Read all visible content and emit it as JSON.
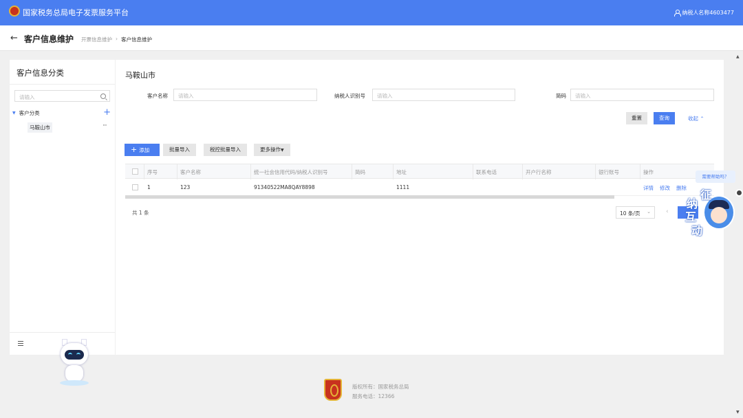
{
  "header": {
    "app_title": "国家税务总局电子发票服务平台",
    "user_name": "纳税人名称4603477"
  },
  "subheader": {
    "page_title": "客户信息维护",
    "breadcrumb": [
      "开票信息维护",
      "客户信息维护"
    ]
  },
  "sidebar": {
    "title": "客户信息分类",
    "search_placeholder": "请输入",
    "tree_root": "客户分类",
    "tree_child": "马鞍山市"
  },
  "main": {
    "region_title": "马鞍山市",
    "form": {
      "customer_name_label": "客户名称",
      "customer_name_placeholder": "请输入",
      "taxpayer_id_label": "纳税人识别号",
      "taxpayer_id_placeholder": "请输入",
      "abbr_label": "简码",
      "abbr_placeholder": "请输入",
      "reset": "重置",
      "query": "查询",
      "collapse": "收起"
    },
    "toolbar": {
      "add": "添加",
      "batch_import": "批量导入",
      "taxctrl_import": "税控批量导入",
      "more": "更多操作"
    },
    "table": {
      "headers": [
        "序号",
        "客户名称",
        "统一社会信用代码/纳税人识别号",
        "简码",
        "地址",
        "联系电话",
        "开户行名称",
        "银行账号",
        "操作"
      ],
      "rows": [
        {
          "index": "1",
          "name": "123",
          "code": "91340522MA8QAY8898",
          "abbr": "",
          "address": "1111",
          "phone": "",
          "bank": "",
          "account": "",
          "ops": [
            "详情",
            "修改",
            "删除"
          ]
        }
      ]
    },
    "pagination": {
      "total": "共 1 条",
      "page_size": "10 条/页"
    }
  },
  "widgets": {
    "help_text": "需要帮助吗？",
    "interact_chars": [
      "征",
      "纳",
      "互",
      "动"
    ]
  },
  "footer": {
    "copyright": "版权所有：国家税务总局",
    "hotline": "服务电话：12366"
  },
  "colors": {
    "primary": "#4a7ef0",
    "header_bg": "#4a7ef0",
    "page_bg": "#f0f0f0"
  }
}
